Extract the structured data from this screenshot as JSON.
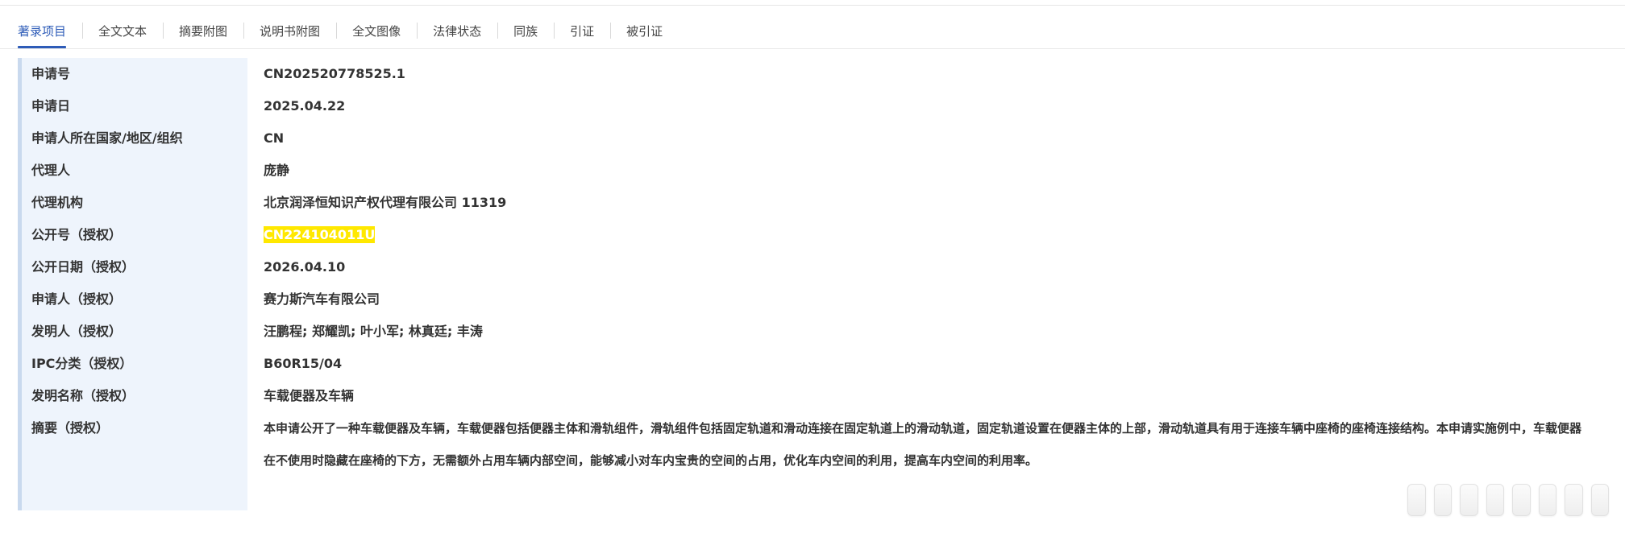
{
  "tabs": [
    {
      "label": "著录项目",
      "active": true
    },
    {
      "label": "全文文本"
    },
    {
      "label": "摘要附图"
    },
    {
      "label": "说明书附图"
    },
    {
      "label": "全文图像"
    },
    {
      "label": "法律状态"
    },
    {
      "label": "同族"
    },
    {
      "label": "引证"
    },
    {
      "label": "被引证"
    }
  ],
  "fields": {
    "application_no": {
      "label": "申请号",
      "value": "CN202520778525.1"
    },
    "application_date": {
      "label": "申请日",
      "value": "2025.04.22"
    },
    "applicant_country": {
      "label": "申请人所在国家/地区/组织",
      "value": "CN"
    },
    "agent": {
      "label": "代理人",
      "value": "庞静"
    },
    "agency": {
      "label": "代理机构",
      "value": "北京润泽恒知识产权代理有限公司 11319"
    },
    "publication_no": {
      "label": "公开号（授权）",
      "value": "CN224104011U"
    },
    "publication_date": {
      "label": "公开日期（授权）",
      "value": "2026.04.10"
    },
    "applicant": {
      "label": "申请人（授权）",
      "value": "赛力斯汽车有限公司"
    },
    "inventors": {
      "label": "发明人（授权）",
      "value": "汪鹏程; 郑耀凯; 叶小军; 林真廷; 丰涛"
    },
    "ipc": {
      "label": "IPC分类（授权）",
      "value": "B60R15/04"
    },
    "title": {
      "label": "发明名称（授权）",
      "value": "车载便器及车辆"
    },
    "abstract": {
      "label": "摘要（授权）",
      "value": "本申请公开了一种车载便器及车辆，车载便器包括便器主体和滑轨组件，滑轨组件包括固定轨道和滑动连接在固定轨道上的滑动轨道，固定轨道设置在便器主体的上部，滑动轨道具有用于连接车辆中座椅的座椅连接结构。本申请实施例中，车载便器在不使用时隐藏在座椅的下方，无需额外占用车辆内部空间，能够减小对车内宝贵的空间的占用，优化车内空间的利用，提高车内空间的利用率。"
    }
  },
  "colors": {
    "accent": "#2e5cb8",
    "label_bg": "#eef4fc",
    "left_border": "#c9d9ee",
    "highlight": "#ffe800"
  }
}
